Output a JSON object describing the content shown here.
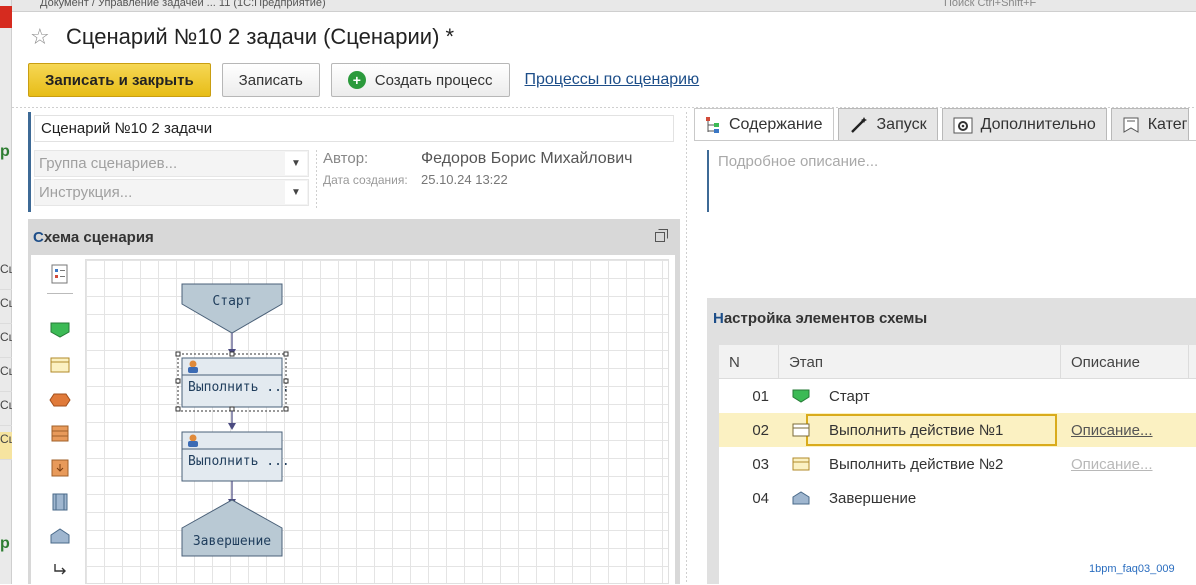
{
  "background": {
    "top_title": "Документ / Управление задачей ... 11 (1С:Предприятие)",
    "search_placeholder": "Поиск Ctrl+Shift+F",
    "left_cells": [
      "Сц",
      "Сц",
      "Сц",
      "Сц",
      "Сц",
      "Сц"
    ]
  },
  "header": {
    "title": "Сценарий №10 2 задачи (Сценарии) *",
    "favorite_icon": "star-icon"
  },
  "toolbar": {
    "save_close_label": "Записать и закрыть",
    "save_label": "Записать",
    "create_process_label": "Создать процесс",
    "processes_link": "Процессы по сценарию"
  },
  "form": {
    "name_value": "Сценарий №10 2 задачи",
    "group_placeholder": "Группа сценариев...",
    "instruction_placeholder": "Инструкция...",
    "author_label": "Автор:",
    "author_value": "Федоров Борис Михайлович",
    "created_label": "Дата создания:",
    "created_value": "25.10.24 13:22"
  },
  "scheme": {
    "title_first": "С",
    "title_rest": "хема сценария",
    "nodes": {
      "start": "Старт",
      "task1": "Выполнить ...",
      "task2": "Выполнить ...",
      "end": "Завершение"
    },
    "palette": [
      "properties-icon",
      "start-shape-icon",
      "task-shape-icon",
      "condition-shape-icon",
      "stack-shape-icon",
      "subprocess-shape-icon",
      "book-shape-icon",
      "end-shape-icon",
      "connector-icon"
    ]
  },
  "tabs": [
    {
      "label": "Содержание",
      "icon": "content-tree-icon",
      "active": true
    },
    {
      "label": "Запуск",
      "icon": "magic-wand-icon",
      "active": false
    },
    {
      "label": "Дополнительно",
      "icon": "gear-icon",
      "active": false
    },
    {
      "label": "Катег",
      "icon": "category-icon",
      "active": false
    }
  ],
  "description_placeholder": "Подробное описание...",
  "settings": {
    "title_first": "Н",
    "title_rest": "астройка элементов схемы",
    "columns": {
      "n": "N",
      "stage": "Этап",
      "desc": "Описание"
    },
    "rows": [
      {
        "n": "01",
        "stage": "Старт",
        "desc": "",
        "icon": "start-shape-icon"
      },
      {
        "n": "02",
        "stage": "Выполнить действие №1",
        "desc": "Описание...",
        "icon": "task-shape-icon"
      },
      {
        "n": "03",
        "stage": "Выполнить действие №2",
        "desc": "Описание...",
        "icon": "task-shape-icon"
      },
      {
        "n": "04",
        "stage": "Завершение",
        "desc": "",
        "icon": "end-shape-icon"
      }
    ]
  },
  "watermark": "1bpm_faq03_009",
  "colors": {
    "accent": "#1d4e89",
    "primary_button": "#e7bd17",
    "selection": "#fbf1c2",
    "shape_fill": "#b9c9d4"
  }
}
